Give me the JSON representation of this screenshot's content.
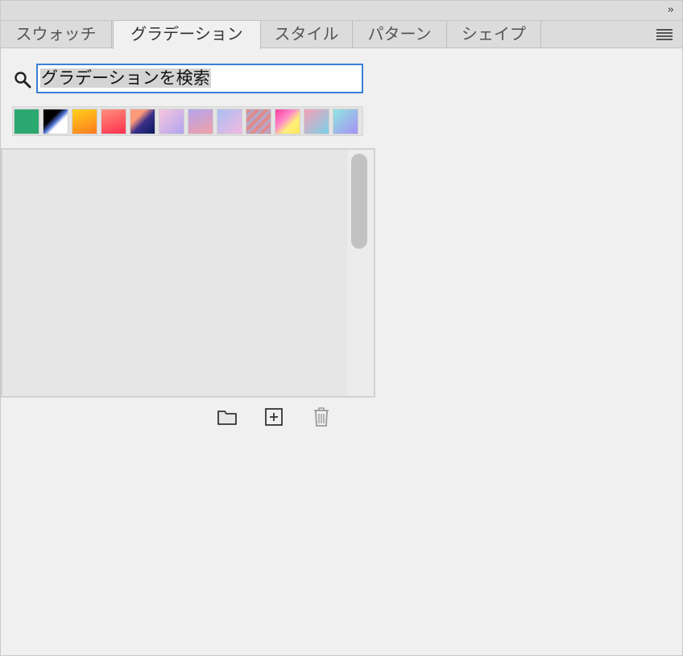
{
  "panel": {
    "collapse_label": "››",
    "tabs": [
      {
        "label": "スウォッチ",
        "active": false
      },
      {
        "label": "グラデーション",
        "active": true
      },
      {
        "label": "スタイル",
        "active": false
      },
      {
        "label": "パターン",
        "active": false
      },
      {
        "label": "シェイプ",
        "active": false
      }
    ],
    "menu_icon": "hamburger-menu-icon"
  },
  "search": {
    "value": "グラデーションを検索",
    "icon": "search-icon"
  },
  "swatches": [
    {
      "name": "green"
    },
    {
      "name": "black-white-diagonal"
    },
    {
      "name": "orange-yellow"
    },
    {
      "name": "red-pink"
    },
    {
      "name": "navy-orange-diagonal"
    },
    {
      "name": "pink-lilac"
    },
    {
      "name": "lilac-rose"
    },
    {
      "name": "periwinkle-pink"
    },
    {
      "name": "rose-stripes"
    },
    {
      "name": "magenta-yellow"
    },
    {
      "name": "pink-cyan"
    },
    {
      "name": "cyan-violet"
    }
  ],
  "footer": {
    "folder_icon": "folder-icon",
    "add_icon": "add-icon",
    "trash_icon": "trash-icon"
  }
}
